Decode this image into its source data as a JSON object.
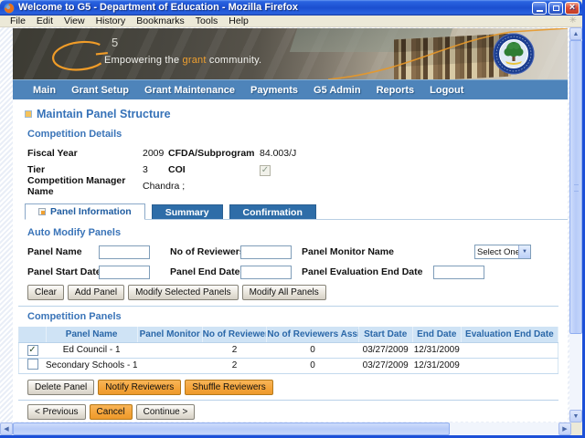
{
  "window": {
    "title": "Welcome to G5 - Department of Education - Mozilla Firefox",
    "menu_items": [
      "File",
      "Edit",
      "View",
      "History",
      "Bookmarks",
      "Tools",
      "Help"
    ]
  },
  "banner": {
    "logo_sup": "5",
    "tagline_prefix": "Empowering the ",
    "tagline_highlight": "grant",
    "tagline_suffix": " community.",
    "accent_color": "#f0a030"
  },
  "nav": {
    "items": [
      "Main",
      "Grant Setup",
      "Grant Maintenance",
      "Payments",
      "G5 Admin",
      "Reports",
      "Logout"
    ],
    "bar_color": "#4e84ba"
  },
  "page": {
    "title": "Maintain Panel Structure",
    "competition_details": {
      "heading": "Competition Details",
      "fiscal_year_label": "Fiscal Year",
      "fiscal_year_value": "2009",
      "cfda_label": "CFDA/Subprogram",
      "cfda_value": "84.003/J",
      "tier_label": "Tier",
      "tier_value": "3",
      "coi_label": "COI",
      "coi_checked": true,
      "coi_check_glyph": "✓",
      "manager_label": "Competition Manager Name",
      "manager_value": "Chandra ;"
    },
    "tabs": [
      {
        "label": "Panel Information",
        "active": true
      },
      {
        "label": "Summary",
        "active": false
      },
      {
        "label": "Confirmation",
        "active": false
      }
    ],
    "auto_modify": {
      "heading": "Auto Modify Panels",
      "panel_name_label": "Panel Name",
      "panel_name_value": "",
      "reviewers_label": "No of Reviewers",
      "reviewers_value": "",
      "monitor_label": "Panel Monitor Name",
      "monitor_value": "Select One",
      "start_date_label": "Panel Start Date",
      "start_date_value": "",
      "end_date_label": "Panel End Date",
      "end_date_value": "",
      "eval_end_date_label": "Panel Evaluation End Date",
      "eval_end_date_value": "",
      "buttons": [
        "Clear",
        "Add Panel",
        "Modify Selected Panels",
        "Modify All Panels"
      ]
    },
    "panels": {
      "heading": "Competition Panels",
      "columns": [
        "Panel Name",
        "Panel Monitor",
        "No of Reviewers",
        "No of Reviewers Assigned",
        "Start Date",
        "End Date",
        "Evaluation End Date"
      ],
      "rows": [
        {
          "checked": true,
          "check_glyph": "✓",
          "panel_name": "Ed Council - 1",
          "panel_monitor": "",
          "no_of_reviewers": "2",
          "no_of_reviewers_assigned": "0",
          "start_date": "03/27/2009",
          "end_date": "12/31/2009",
          "evaluation_end_date": ""
        },
        {
          "checked": false,
          "check_glyph": "",
          "panel_name": "Secondary Schools - 1",
          "panel_monitor": "",
          "no_of_reviewers": "2",
          "no_of_reviewers_assigned": "0",
          "start_date": "03/27/2009",
          "end_date": "12/31/2009",
          "evaluation_end_date": ""
        }
      ],
      "buttons": [
        {
          "label": "Delete Panel",
          "style": "gray"
        },
        {
          "label": "Notify Reviewers",
          "style": "orange"
        },
        {
          "label": "Shuffle Reviewers",
          "style": "orange"
        }
      ]
    },
    "footer_buttons": [
      {
        "label": "< Previous",
        "style": "gray"
      },
      {
        "label": "Cancel",
        "style": "orange"
      },
      {
        "label": "Continue >",
        "style": "gray"
      }
    ]
  },
  "colors": {
    "button_orange": "#f4a338",
    "heading_blue": "#3a74b8",
    "table_header_bg": "#cfe3f5"
  }
}
